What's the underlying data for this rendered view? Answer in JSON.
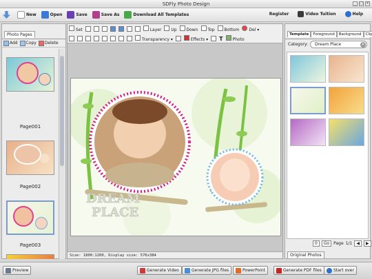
{
  "app": {
    "title": "SDFly Photo Design"
  },
  "toolbar": {
    "new": "New",
    "open": "Open",
    "save": "Save",
    "save_as": "Save As",
    "download_templates": "Download All Templates",
    "register": "Register",
    "video_tuition": "Video Tuition",
    "help": "Help"
  },
  "left_panel": {
    "tab": "Photo Pages",
    "add": "Add",
    "copy": "Copy",
    "delete": "Delete",
    "pages": [
      "Page001",
      "Page002",
      "Page003"
    ]
  },
  "edit_toolbar": {
    "set": "Set",
    "layer": "Layer",
    "up": "Up",
    "down": "Down",
    "top": "Top",
    "bottom": "Bottom",
    "del": "Del",
    "transparency": "Transparency",
    "effects": "Effects",
    "text": "T",
    "photo": "Photo"
  },
  "canvas": {
    "title_line1": "DREAM",
    "title_line2": "PLACE"
  },
  "status": {
    "text": "Size: 1800:1200, Display size: 576x384"
  },
  "right_panel": {
    "tabs": [
      "Template",
      "Foreground",
      "Background",
      "Clipart"
    ],
    "category_label": "Category:",
    "category_value": "Dream Place",
    "page_input": "0",
    "go": "Go",
    "page_label": "Page",
    "page_count": "1/1",
    "original_photos": "Original Photos"
  },
  "bottom": {
    "preview": "Preview",
    "gen_video": "Generate Video",
    "gen_jpg": "Generate JPG files",
    "powerpoint": "PowerPoint",
    "gen_pdf": "Generate PDF files",
    "start_over": "Start over"
  },
  "colors": {
    "accent_pink": "#d81b8c",
    "leaf_green": "#7cc242",
    "sky_blue": "#6fb6e8"
  }
}
